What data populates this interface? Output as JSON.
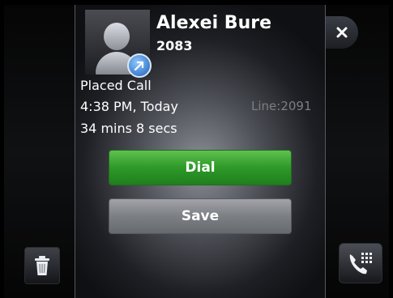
{
  "contact": {
    "name": "Alexei Bure",
    "number": "2083"
  },
  "call": {
    "type": "Placed Call",
    "time": "4:38 PM, Today",
    "duration": "34 mins 8 secs",
    "line": "Line:2091"
  },
  "actions": {
    "dial_label": "Dial",
    "save_label": "Save"
  },
  "icons": {
    "close": "close-icon",
    "trash": "trash-icon",
    "dialpad": "phone-dialpad-icon",
    "avatar": "person-icon",
    "placed_call": "outgoing-call-arrow-icon"
  },
  "colors": {
    "dial_button": "#2f9a2a",
    "save_button": "#7d8085",
    "line_text": "#7b7e84"
  }
}
